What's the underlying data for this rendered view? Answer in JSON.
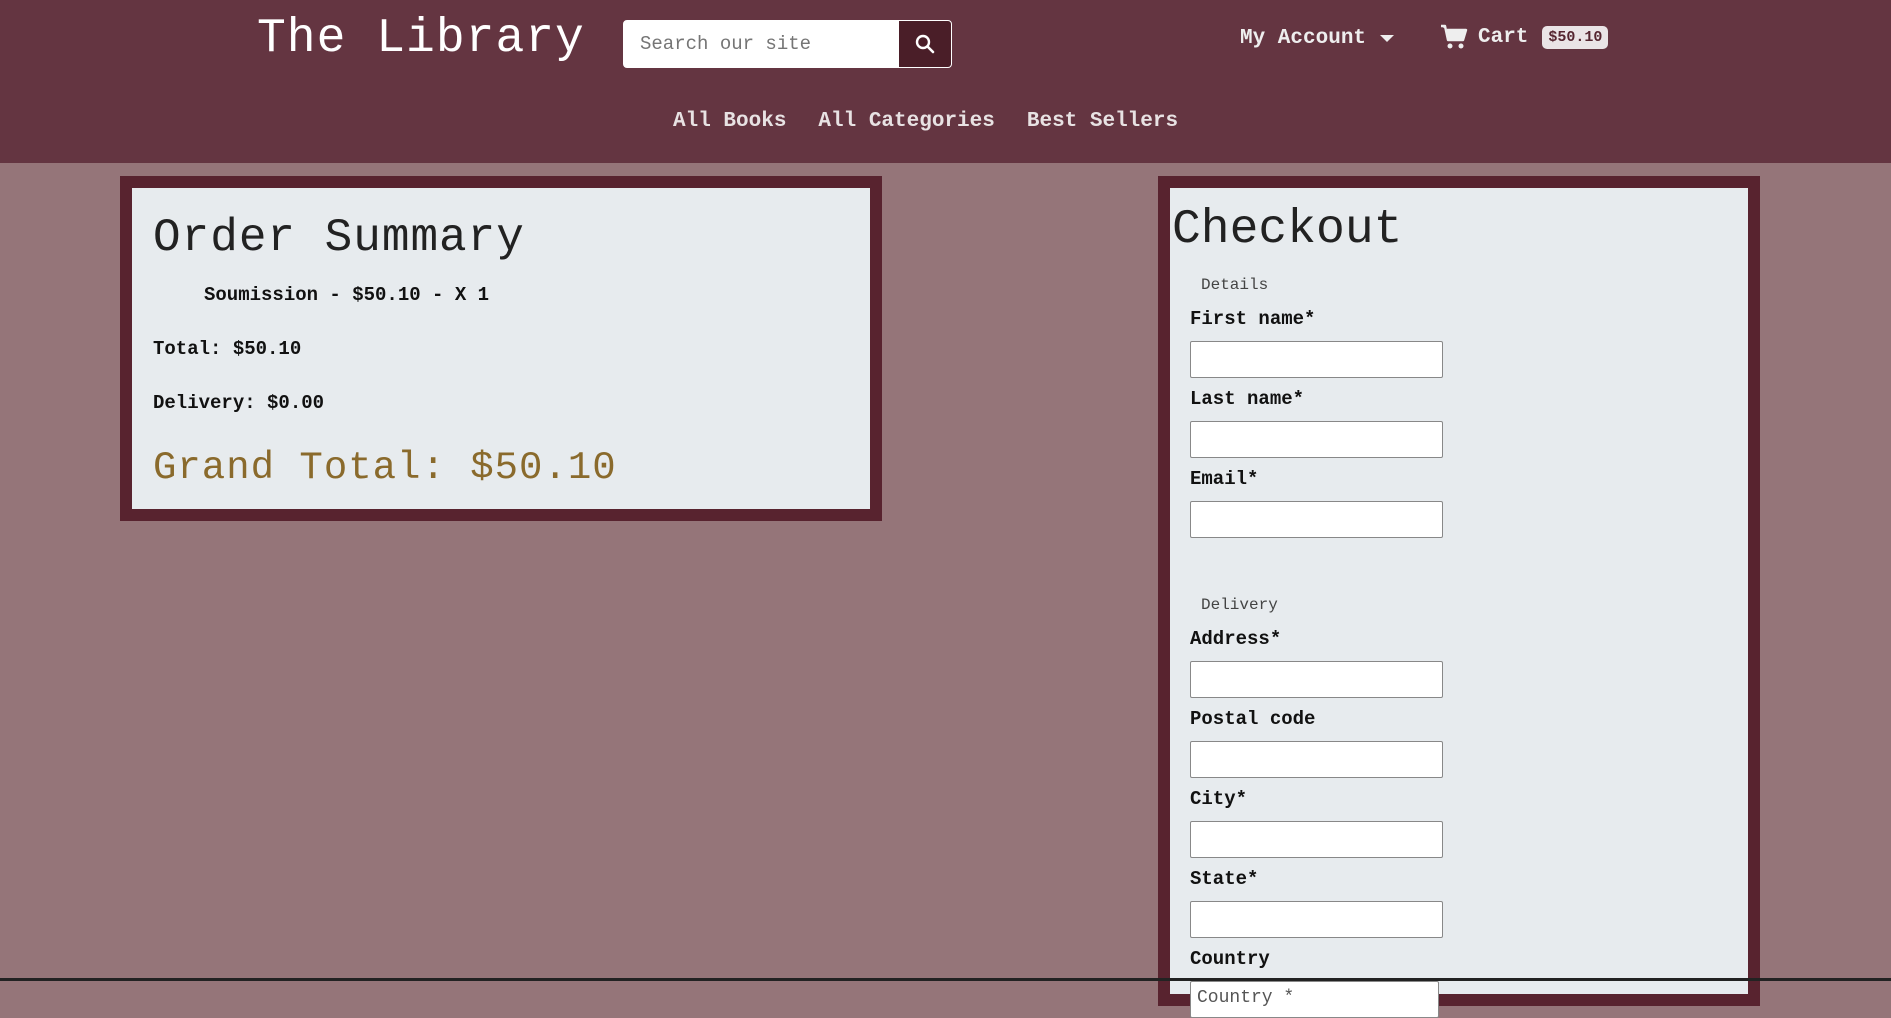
{
  "header": {
    "brand": "The Library",
    "search_placeholder": "Search our site",
    "account_label": "My Account",
    "cart_label": "Cart",
    "cart_total": "$50.10"
  },
  "nav": {
    "items": [
      "All Books",
      "All Categories",
      "Best Sellers"
    ]
  },
  "order_summary": {
    "title": "Order Summary",
    "item_line": "Soumission - $50.10 - X 1",
    "total": "Total: $50.10",
    "delivery": "Delivery: $0.00",
    "grand_total": "Grand Total: $50.10"
  },
  "checkout": {
    "title": "Checkout",
    "details_legend": "Details",
    "first_name_label": "First name*",
    "last_name_label": "Last name*",
    "email_label": "Email*",
    "delivery_legend": "Delivery",
    "address_label": "Address*",
    "postal_label": "Postal code",
    "city_label": "City*",
    "state_label": "State*",
    "country_label": "Country",
    "country_select": "Country *"
  },
  "colors": {
    "header_bg": "#643541",
    "page_bg": "#957579",
    "panel_border": "#58232f",
    "grand_total": "#8a6a2c"
  }
}
